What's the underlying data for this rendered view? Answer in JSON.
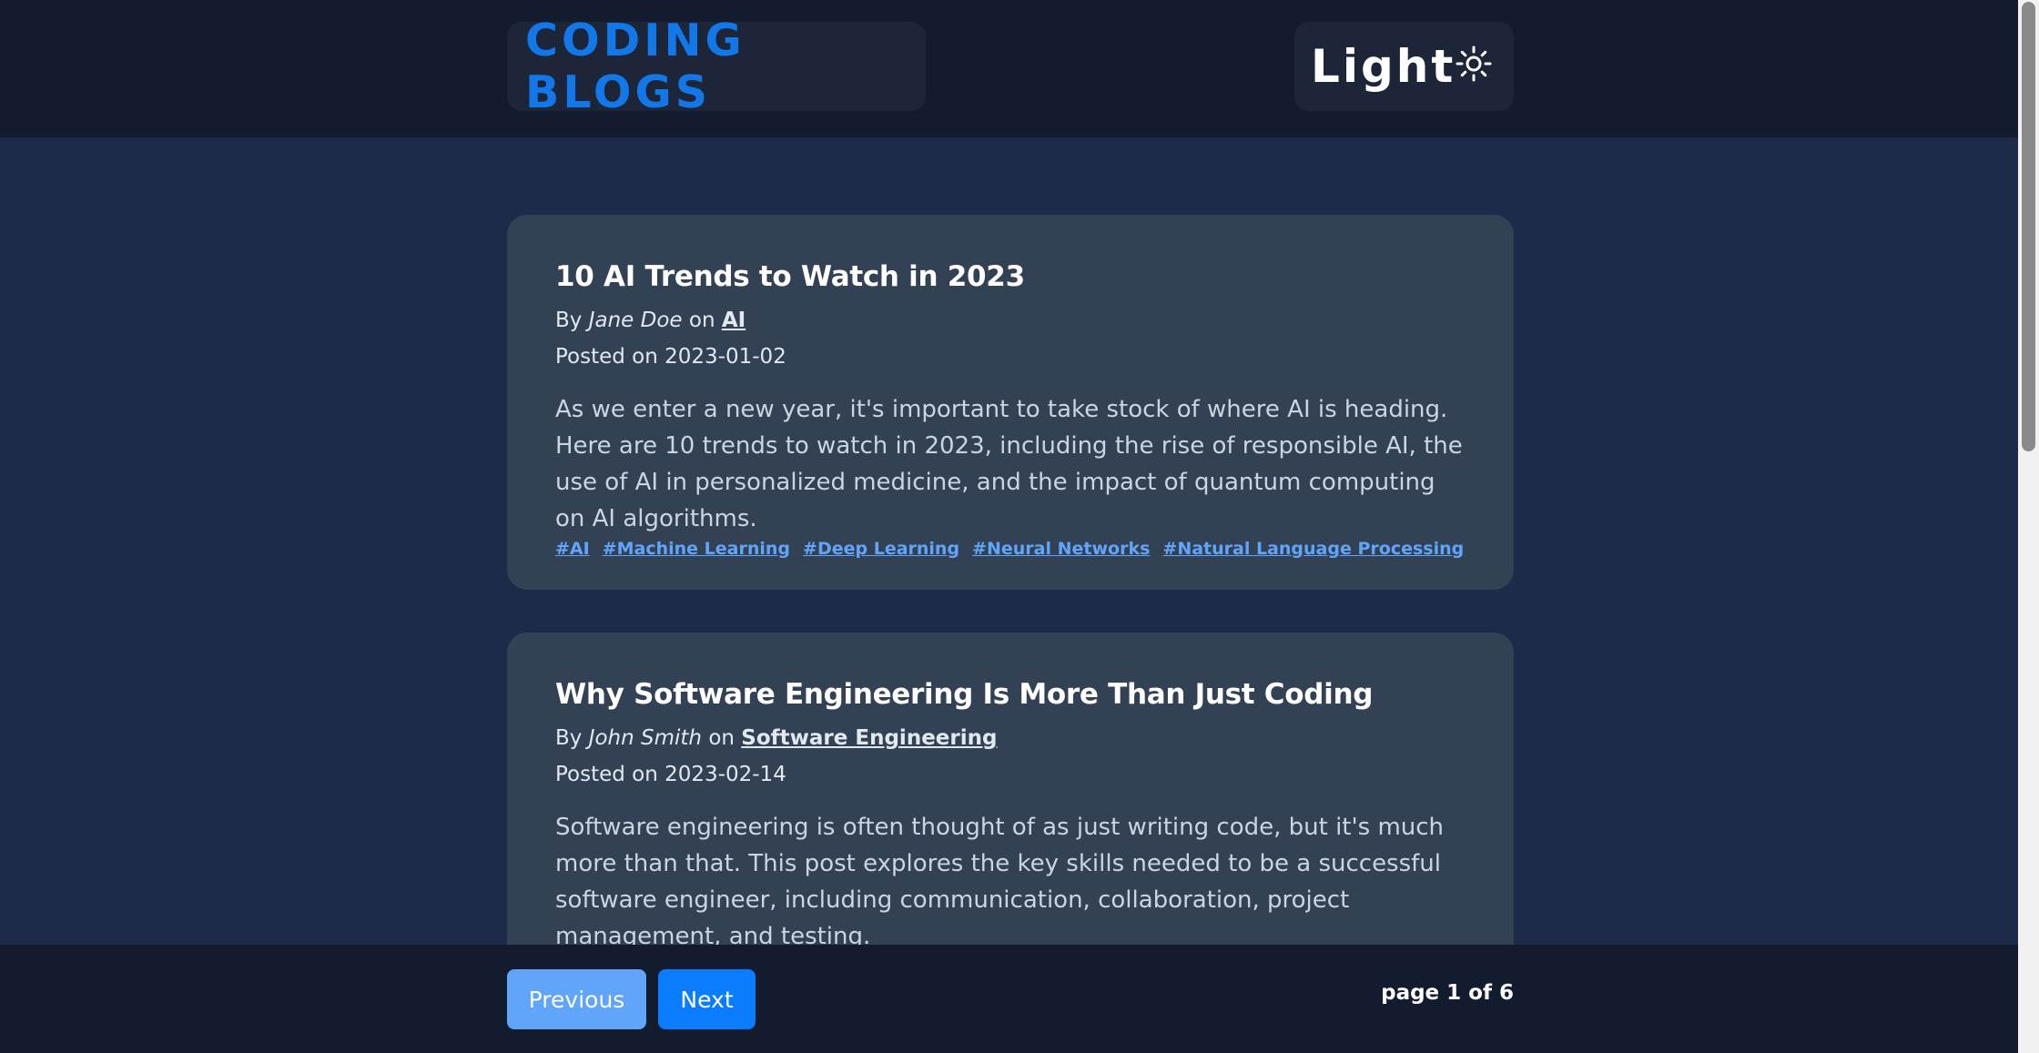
{
  "header": {
    "logo": "CODING BLOGS",
    "theme_toggle_label": "Light",
    "theme_icon": "sun-icon"
  },
  "posts": [
    {
      "title": "10 AI Trends to Watch in 2023",
      "by_label": "By",
      "author": "Jane Doe",
      "on_label": "on",
      "category": "AI",
      "posted_label": "Posted on",
      "date": "2023-01-02",
      "excerpt": "As we enter a new year, it's important to take stock of where AI is heading. Here are 10 trends to watch in 2023, including the rise of responsible AI, the use of AI in personalized medicine, and the impact of quantum computing on AI algorithms.",
      "tags": [
        "#AI",
        "#Machine Learning",
        "#Deep Learning",
        "#Neural Networks",
        "#Natural Language Processing"
      ]
    },
    {
      "title": "Why Software Engineering Is More Than Just Coding",
      "by_label": "By",
      "author": "John Smith",
      "on_label": "on",
      "category": "Software Engineering",
      "posted_label": "Posted on",
      "date": "2023-02-14",
      "excerpt": "Software engineering is often thought of as just writing code, but it's much more than that. This post explores the key skills needed to be a successful software engineer, including communication, collaboration, project management, and testing."
    }
  ],
  "footer": {
    "previous_label": "Previous",
    "next_label": "Next",
    "page_info": "page 1 of 6"
  },
  "colors": {
    "background": "#1e2a4a",
    "header_bg": "#131b2f",
    "card_bg": "#334155",
    "brand_blue": "#1277e8",
    "tag_blue": "#60a5fa",
    "next_button": "#0a7cff"
  }
}
